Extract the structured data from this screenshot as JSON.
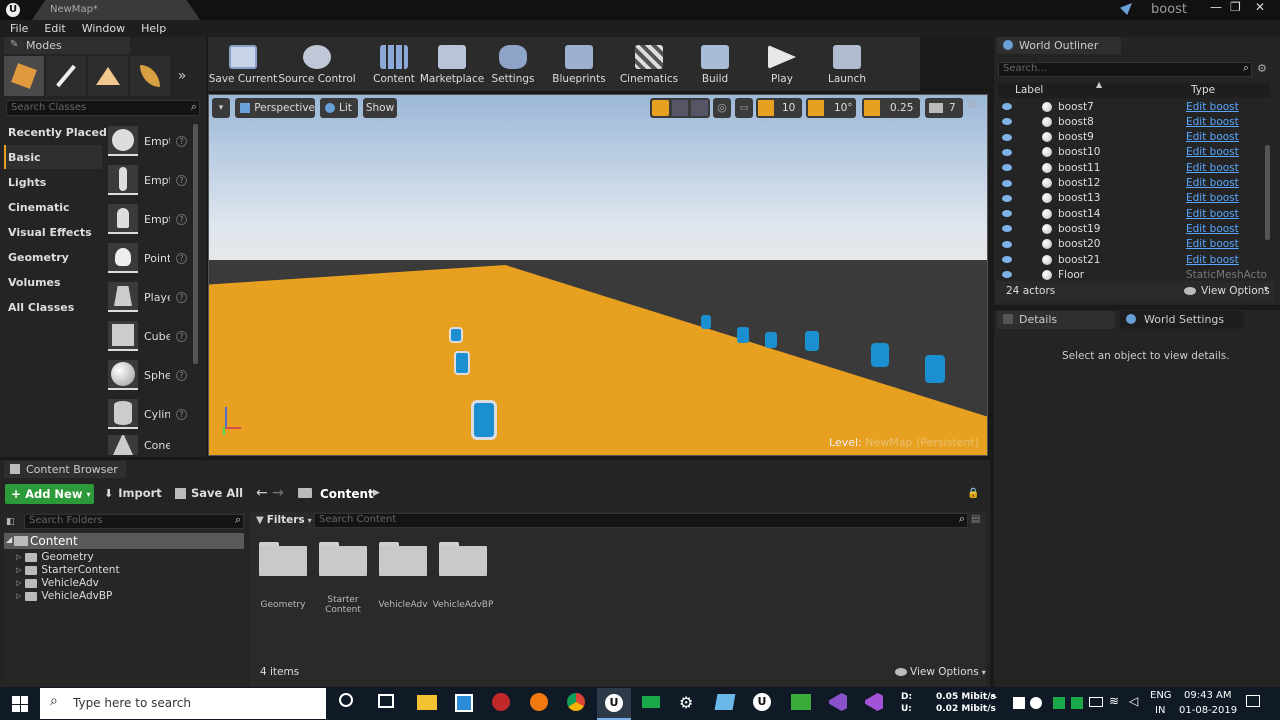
{
  "window": {
    "tab": "NewMap*",
    "project": "boost",
    "controls": [
      "—",
      "❐",
      "✕"
    ]
  },
  "menu": [
    "File",
    "Edit",
    "Window",
    "Help"
  ],
  "modes": {
    "title": "Modes",
    "search_placeholder": "Search Classes",
    "categories": [
      "Recently Placed",
      "Basic",
      "Lights",
      "Cinematic",
      "Visual Effects",
      "Geometry",
      "Volumes",
      "All Classes"
    ],
    "classes": [
      "Empt",
      "Empt",
      "Empt",
      "Point",
      "Playe",
      "Cube",
      "Sphe",
      "Cylin",
      "Cone"
    ]
  },
  "toolbar": [
    "Save Current",
    "Source Control",
    "Content",
    "Marketplace",
    "Settings",
    "Blueprints",
    "Cinematics",
    "Build",
    "Play",
    "Launch"
  ],
  "viewport": {
    "perspective": "Perspective",
    "lit": "Lit",
    "show": "Show",
    "grid": "10",
    "rotation": "10°",
    "scale": "0.25",
    "camera_speed": "7",
    "level_label": "Level:",
    "level_name": "NewMap (Persistent)"
  },
  "outliner": {
    "title": "World Outliner",
    "search_placeholder": "Search...",
    "col_label": "Label",
    "col_type": "Type",
    "rows": [
      {
        "name": "boost7",
        "type": "Edit boost"
      },
      {
        "name": "boost8",
        "type": "Edit boost"
      },
      {
        "name": "boost9",
        "type": "Edit boost"
      },
      {
        "name": "boost10",
        "type": "Edit boost"
      },
      {
        "name": "boost11",
        "type": "Edit boost"
      },
      {
        "name": "boost12",
        "type": "Edit boost"
      },
      {
        "name": "boost13",
        "type": "Edit boost"
      },
      {
        "name": "boost14",
        "type": "Edit boost"
      },
      {
        "name": "boost19",
        "type": "Edit boost"
      },
      {
        "name": "boost20",
        "type": "Edit boost"
      },
      {
        "name": "boost21",
        "type": "Edit boost"
      },
      {
        "name": "Floor",
        "type": "StaticMeshActo"
      }
    ],
    "count": "24 actors",
    "view_options": "View Options"
  },
  "details": {
    "tab1": "Details",
    "tab2": "World Settings",
    "empty": "Select an object to view details."
  },
  "content_browser": {
    "title": "Content Browser",
    "add_new": "Add New",
    "import": "Import",
    "save_all": "Save All",
    "path": "Content",
    "search_folders": "Search Folders",
    "filters": "Filters",
    "search_content": "Search Content",
    "tree_root": "Content",
    "tree": [
      "Geometry",
      "StarterContent",
      "VehicleAdv",
      "VehicleAdvBP"
    ],
    "assets": [
      "Geometry",
      "Starter\nContent",
      "VehicleAdv",
      "VehicleAdvBP"
    ],
    "item_count": "4 items",
    "view_options": "View Options"
  },
  "taskbar": {
    "search": "Type here to search",
    "net_up": "0.05 Mibit/s",
    "net_down": "0.02 Mibit/s",
    "net_lbl_up": "D:",
    "net_lbl_dn": "U:",
    "lang1": "ENG",
    "lang2": "IN",
    "time": "09:43 AM",
    "date": "01-08-2019"
  },
  "colors": {
    "accent": "#2a7fd4",
    "floor": "#e8a020",
    "addnew": "#2d9a3a",
    "link": "#5aa7ff"
  }
}
